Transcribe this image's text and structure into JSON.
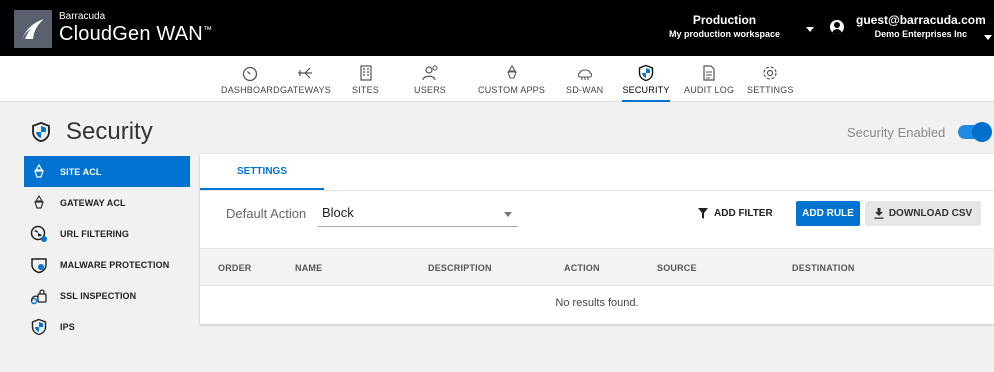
{
  "header": {
    "brand_small": "Barracuda",
    "brand_name": "CloudGen WAN",
    "brand_tm": "™",
    "workspace_name": "Production",
    "workspace_sub": "My production workspace",
    "user_email": "guest@barracuda.com",
    "user_org": "Demo Enterprises Inc"
  },
  "nav": {
    "items": [
      {
        "label": "DASHBOARD",
        "icon": "dashboard-icon"
      },
      {
        "label": "GATEWAYS",
        "icon": "gateways-icon"
      },
      {
        "label": "SITES",
        "icon": "sites-icon"
      },
      {
        "label": "USERS",
        "icon": "users-icon"
      },
      {
        "label": "CUSTOM APPS",
        "icon": "custom-apps-icon"
      },
      {
        "label": "SD-WAN",
        "icon": "sd-wan-icon"
      },
      {
        "label": "SECURITY",
        "icon": "security-icon"
      },
      {
        "label": "AUDIT LOG",
        "icon": "audit-log-icon"
      },
      {
        "label": "SETTINGS",
        "icon": "settings-icon"
      }
    ],
    "active": "SECURITY"
  },
  "page": {
    "title": "Security",
    "security_enabled_label": "Security Enabled",
    "security_enabled": true
  },
  "sidebar": {
    "items": [
      {
        "label": "SITE ACL",
        "icon": "site-acl-icon"
      },
      {
        "label": "GATEWAY ACL",
        "icon": "gateway-acl-icon"
      },
      {
        "label": "URL FILTERING",
        "icon": "url-filtering-icon"
      },
      {
        "label": "MALWARE PROTECTION",
        "icon": "malware-protection-icon"
      },
      {
        "label": "SSL INSPECTION",
        "icon": "ssl-inspection-icon"
      },
      {
        "label": "IPS",
        "icon": "ips-icon"
      }
    ],
    "active": "SITE ACL"
  },
  "content": {
    "tab_label": "SETTINGS",
    "default_action_label": "Default Action",
    "default_action_value": "Block",
    "add_filter_label": "ADD FILTER",
    "add_rule_label": "ADD RULE",
    "download_csv_label": "DOWNLOAD CSV",
    "columns": [
      "ORDER",
      "NAME",
      "DESCRIPTION",
      "ACTION",
      "SOURCE",
      "DESTINATION"
    ],
    "empty_message": "No results found."
  },
  "colors": {
    "accent": "#0073d1",
    "topbar": "#000000",
    "background": "#f1f1f1"
  }
}
